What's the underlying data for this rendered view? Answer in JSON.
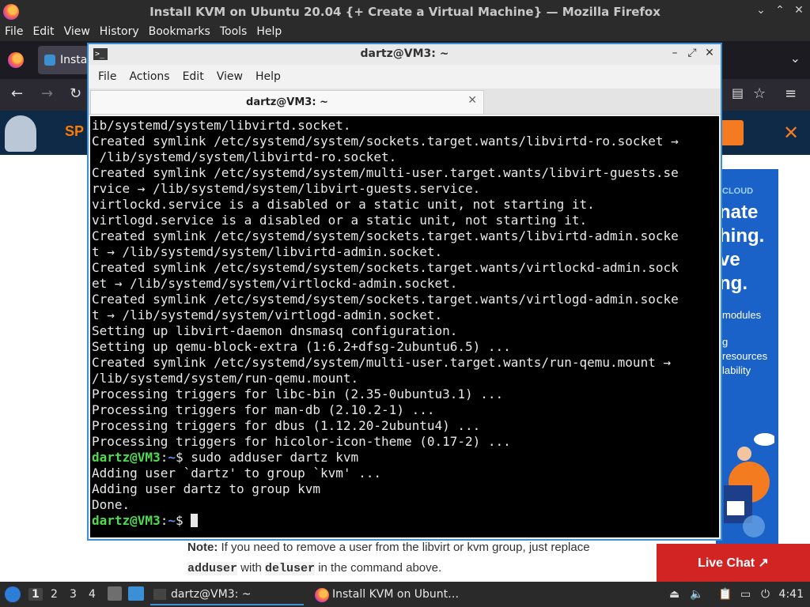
{
  "firefox": {
    "title": "Install KVM on Ubuntu 20.04 {+ Create a Virtual Machine} — Mozilla Firefox",
    "menu": [
      "File",
      "Edit",
      "View",
      "History",
      "Bookmarks",
      "Tools",
      "Help"
    ],
    "tab_label": "Insta",
    "window_buttons": {
      "minimize": "⌄",
      "maximize": "⌃",
      "close": "✕"
    }
  },
  "page": {
    "banner_logo_text": "SP",
    "banner_close": "✕",
    "ad": {
      "cloud": "CLOUD",
      "big_lines": [
        "nate",
        "hing.",
        "ve",
        "ng."
      ],
      "small_lines": [
        "modules",
        "g",
        "resources",
        "lability"
      ]
    },
    "note_label": "Note:",
    "note_text1": " If you need to remove a user from the libvirt or kvm group, just replace",
    "note_code1": "adduser",
    "note_text2": " with ",
    "note_code2": "deluser",
    "note_text3": " in the command above.",
    "live_chat": "Live Chat ↗"
  },
  "terminal": {
    "title": "dartz@VM3: ~",
    "menu": [
      "File",
      "Actions",
      "Edit",
      "View",
      "Help"
    ],
    "tab_label": "dartz@VM3: ~",
    "tab_close": "✕",
    "lines": [
      "ib/systemd/system/libvirtd.socket.",
      "Created symlink /etc/systemd/system/sockets.target.wants/libvirtd-ro.socket →",
      " /lib/systemd/system/libvirtd-ro.socket.",
      "Created symlink /etc/systemd/system/multi-user.target.wants/libvirt-guests.se",
      "rvice → /lib/systemd/system/libvirt-guests.service.",
      "virtlockd.service is a disabled or a static unit, not starting it.",
      "virtlogd.service is a disabled or a static unit, not starting it.",
      "Created symlink /etc/systemd/system/sockets.target.wants/libvirtd-admin.socke",
      "t → /lib/systemd/system/libvirtd-admin.socket.",
      "Created symlink /etc/systemd/system/sockets.target.wants/virtlockd-admin.sock",
      "et → /lib/systemd/system/virtlockd-admin.socket.",
      "Created symlink /etc/systemd/system/sockets.target.wants/virtlogd-admin.socke",
      "t → /lib/systemd/system/virtlogd-admin.socket.",
      "Setting up libvirt-daemon dnsmasq configuration.",
      "Setting up qemu-block-extra (1:6.2+dfsg-2ubuntu6.5) ...",
      "Created symlink /etc/systemd/system/multi-user.target.wants/run-qemu.mount →",
      "/lib/systemd/system/run-qemu.mount.",
      "Processing triggers for libc-bin (2.35-0ubuntu3.1) ...",
      "Processing triggers for man-db (2.10.2-1) ...",
      "Processing triggers for dbus (1.12.20-2ubuntu4) ...",
      "Processing triggers for hicolor-icon-theme (0.17-2) ..."
    ],
    "prompt_user": "dartz@VM3",
    "prompt_sep": ":",
    "prompt_path": "~",
    "prompt_dollar": "$ ",
    "command": "sudo adduser dartz kvm",
    "output_after": [
      "Adding user `dartz' to group `kvm' ...",
      "Adding user dartz to group kvm",
      "Done."
    ]
  },
  "panel": {
    "workspaces": [
      "1",
      "2",
      "3",
      "4"
    ],
    "task_terminal": "dartz@VM3: ~",
    "task_firefox": "Install KVM on Ubunt…",
    "clock": "4:41"
  },
  "colors": {
    "prompt_user": "#4edc4e",
    "prompt_path": "#5a8fe8",
    "terminal_border": "#3b8fd6",
    "live_chat": "#d32424"
  }
}
